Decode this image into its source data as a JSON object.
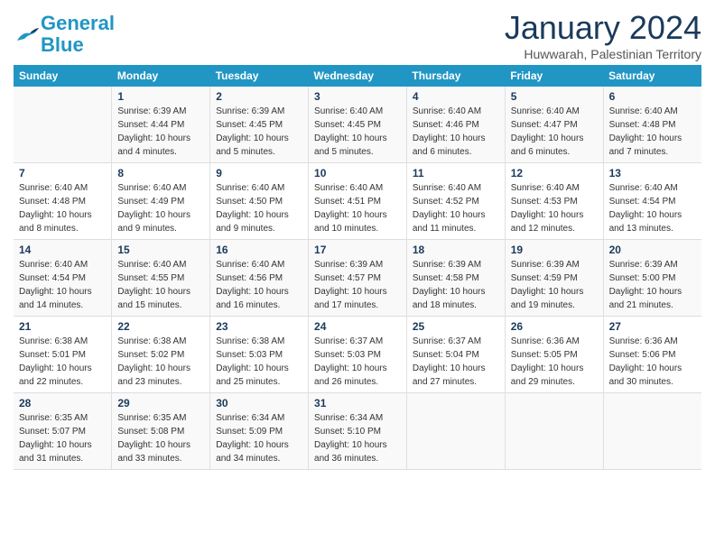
{
  "logo": {
    "line1": "General",
    "line2": "Blue"
  },
  "title": "January 2024",
  "location": "Huwwarah, Palestinian Territory",
  "weekdays": [
    "Sunday",
    "Monday",
    "Tuesday",
    "Wednesday",
    "Thursday",
    "Friday",
    "Saturday"
  ],
  "weeks": [
    [
      {
        "day": "",
        "sunrise": "",
        "sunset": "",
        "daylight": ""
      },
      {
        "day": "1",
        "sunrise": "Sunrise: 6:39 AM",
        "sunset": "Sunset: 4:44 PM",
        "daylight": "Daylight: 10 hours and 4 minutes."
      },
      {
        "day": "2",
        "sunrise": "Sunrise: 6:39 AM",
        "sunset": "Sunset: 4:45 PM",
        "daylight": "Daylight: 10 hours and 5 minutes."
      },
      {
        "day": "3",
        "sunrise": "Sunrise: 6:40 AM",
        "sunset": "Sunset: 4:45 PM",
        "daylight": "Daylight: 10 hours and 5 minutes."
      },
      {
        "day": "4",
        "sunrise": "Sunrise: 6:40 AM",
        "sunset": "Sunset: 4:46 PM",
        "daylight": "Daylight: 10 hours and 6 minutes."
      },
      {
        "day": "5",
        "sunrise": "Sunrise: 6:40 AM",
        "sunset": "Sunset: 4:47 PM",
        "daylight": "Daylight: 10 hours and 6 minutes."
      },
      {
        "day": "6",
        "sunrise": "Sunrise: 6:40 AM",
        "sunset": "Sunset: 4:48 PM",
        "daylight": "Daylight: 10 hours and 7 minutes."
      }
    ],
    [
      {
        "day": "7",
        "sunrise": "Sunrise: 6:40 AM",
        "sunset": "Sunset: 4:48 PM",
        "daylight": "Daylight: 10 hours and 8 minutes."
      },
      {
        "day": "8",
        "sunrise": "Sunrise: 6:40 AM",
        "sunset": "Sunset: 4:49 PM",
        "daylight": "Daylight: 10 hours and 9 minutes."
      },
      {
        "day": "9",
        "sunrise": "Sunrise: 6:40 AM",
        "sunset": "Sunset: 4:50 PM",
        "daylight": "Daylight: 10 hours and 9 minutes."
      },
      {
        "day": "10",
        "sunrise": "Sunrise: 6:40 AM",
        "sunset": "Sunset: 4:51 PM",
        "daylight": "Daylight: 10 hours and 10 minutes."
      },
      {
        "day": "11",
        "sunrise": "Sunrise: 6:40 AM",
        "sunset": "Sunset: 4:52 PM",
        "daylight": "Daylight: 10 hours and 11 minutes."
      },
      {
        "day": "12",
        "sunrise": "Sunrise: 6:40 AM",
        "sunset": "Sunset: 4:53 PM",
        "daylight": "Daylight: 10 hours and 12 minutes."
      },
      {
        "day": "13",
        "sunrise": "Sunrise: 6:40 AM",
        "sunset": "Sunset: 4:54 PM",
        "daylight": "Daylight: 10 hours and 13 minutes."
      }
    ],
    [
      {
        "day": "14",
        "sunrise": "Sunrise: 6:40 AM",
        "sunset": "Sunset: 4:54 PM",
        "daylight": "Daylight: 10 hours and 14 minutes."
      },
      {
        "day": "15",
        "sunrise": "Sunrise: 6:40 AM",
        "sunset": "Sunset: 4:55 PM",
        "daylight": "Daylight: 10 hours and 15 minutes."
      },
      {
        "day": "16",
        "sunrise": "Sunrise: 6:40 AM",
        "sunset": "Sunset: 4:56 PM",
        "daylight": "Daylight: 10 hours and 16 minutes."
      },
      {
        "day": "17",
        "sunrise": "Sunrise: 6:39 AM",
        "sunset": "Sunset: 4:57 PM",
        "daylight": "Daylight: 10 hours and 17 minutes."
      },
      {
        "day": "18",
        "sunrise": "Sunrise: 6:39 AM",
        "sunset": "Sunset: 4:58 PM",
        "daylight": "Daylight: 10 hours and 18 minutes."
      },
      {
        "day": "19",
        "sunrise": "Sunrise: 6:39 AM",
        "sunset": "Sunset: 4:59 PM",
        "daylight": "Daylight: 10 hours and 19 minutes."
      },
      {
        "day": "20",
        "sunrise": "Sunrise: 6:39 AM",
        "sunset": "Sunset: 5:00 PM",
        "daylight": "Daylight: 10 hours and 21 minutes."
      }
    ],
    [
      {
        "day": "21",
        "sunrise": "Sunrise: 6:38 AM",
        "sunset": "Sunset: 5:01 PM",
        "daylight": "Daylight: 10 hours and 22 minutes."
      },
      {
        "day": "22",
        "sunrise": "Sunrise: 6:38 AM",
        "sunset": "Sunset: 5:02 PM",
        "daylight": "Daylight: 10 hours and 23 minutes."
      },
      {
        "day": "23",
        "sunrise": "Sunrise: 6:38 AM",
        "sunset": "Sunset: 5:03 PM",
        "daylight": "Daylight: 10 hours and 25 minutes."
      },
      {
        "day": "24",
        "sunrise": "Sunrise: 6:37 AM",
        "sunset": "Sunset: 5:03 PM",
        "daylight": "Daylight: 10 hours and 26 minutes."
      },
      {
        "day": "25",
        "sunrise": "Sunrise: 6:37 AM",
        "sunset": "Sunset: 5:04 PM",
        "daylight": "Daylight: 10 hours and 27 minutes."
      },
      {
        "day": "26",
        "sunrise": "Sunrise: 6:36 AM",
        "sunset": "Sunset: 5:05 PM",
        "daylight": "Daylight: 10 hours and 29 minutes."
      },
      {
        "day": "27",
        "sunrise": "Sunrise: 6:36 AM",
        "sunset": "Sunset: 5:06 PM",
        "daylight": "Daylight: 10 hours and 30 minutes."
      }
    ],
    [
      {
        "day": "28",
        "sunrise": "Sunrise: 6:35 AM",
        "sunset": "Sunset: 5:07 PM",
        "daylight": "Daylight: 10 hours and 31 minutes."
      },
      {
        "day": "29",
        "sunrise": "Sunrise: 6:35 AM",
        "sunset": "Sunset: 5:08 PM",
        "daylight": "Daylight: 10 hours and 33 minutes."
      },
      {
        "day": "30",
        "sunrise": "Sunrise: 6:34 AM",
        "sunset": "Sunset: 5:09 PM",
        "daylight": "Daylight: 10 hours and 34 minutes."
      },
      {
        "day": "31",
        "sunrise": "Sunrise: 6:34 AM",
        "sunset": "Sunset: 5:10 PM",
        "daylight": "Daylight: 10 hours and 36 minutes."
      },
      {
        "day": "",
        "sunrise": "",
        "sunset": "",
        "daylight": ""
      },
      {
        "day": "",
        "sunrise": "",
        "sunset": "",
        "daylight": ""
      },
      {
        "day": "",
        "sunrise": "",
        "sunset": "",
        "daylight": ""
      }
    ]
  ]
}
